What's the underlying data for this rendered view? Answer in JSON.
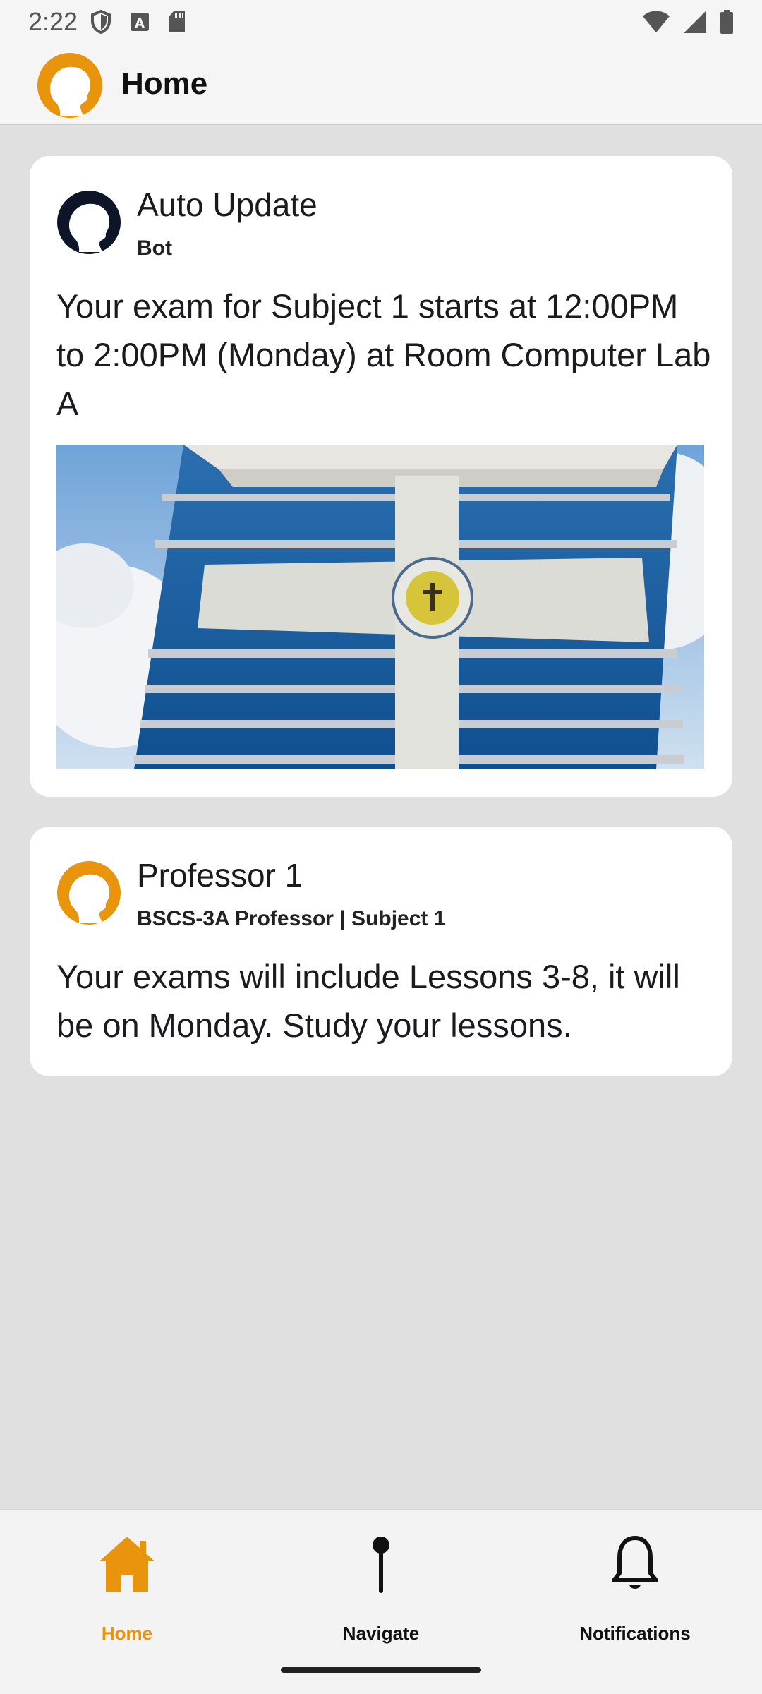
{
  "status_bar": {
    "time": "2:22",
    "icons_left": [
      "shield-icon",
      "font-a-icon",
      "sd-card-icon"
    ],
    "icons_right": [
      "wifi-icon",
      "signal-icon",
      "battery-icon"
    ]
  },
  "app_bar": {
    "title": "Home",
    "logo": "profile-silhouette-logo",
    "accent_color": "#E8940C"
  },
  "posts": [
    {
      "author": "Auto Update",
      "role": "Bot",
      "avatar_color": "#0f1528",
      "body": "Your exam for Subject 1 starts at 12:00PM to 2:00PM (Monday) at Room Computer Lab A",
      "image": "school-building-photo"
    },
    {
      "author": "Professor 1",
      "role": "BSCS-3A Professor | Subject 1",
      "avatar_color": "#E8940C",
      "body": "Your exams will include Lessons 3-8, it will be on Monday. Study your lessons."
    }
  ],
  "bottom_nav": {
    "active_color": "#E8940C",
    "items": [
      {
        "label": "Home",
        "icon": "home-icon",
        "active": true
      },
      {
        "label": "Navigate",
        "icon": "map-pin-icon",
        "active": false
      },
      {
        "label": "Notifications",
        "icon": "bell-icon",
        "active": false
      }
    ]
  }
}
